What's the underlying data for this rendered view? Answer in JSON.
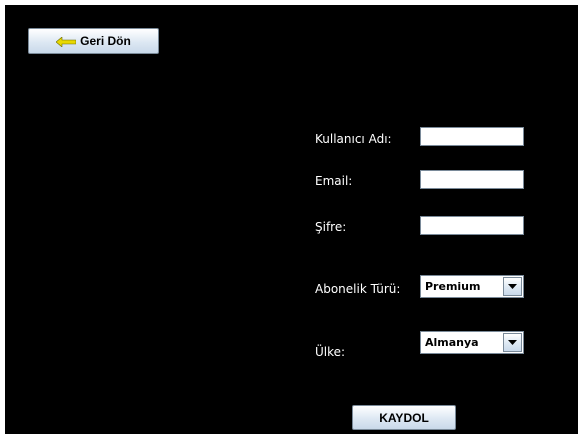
{
  "toolbar": {
    "back_label": "Geri Dön",
    "back_icon": "arrow-left-icon",
    "back_icon_color": "#e8d800"
  },
  "form": {
    "username_label": "Kullanıcı Adı:",
    "username_value": "",
    "email_label": "Email:",
    "email_value": "",
    "password_label": "Şifre:",
    "password_value": "",
    "subscription_label": "Abonelik Türü:",
    "subscription_selected": "Premium",
    "country_label": "Ülke:",
    "country_selected": "Almanya",
    "dropdown_icon": "caret-down-icon",
    "save_label": "KAYDOL"
  },
  "colors": {
    "panel_background": "#000000",
    "label_text": "#ffffff",
    "button_gradient_top": "#ffffff",
    "button_gradient_bottom": "#c9d9ea"
  }
}
